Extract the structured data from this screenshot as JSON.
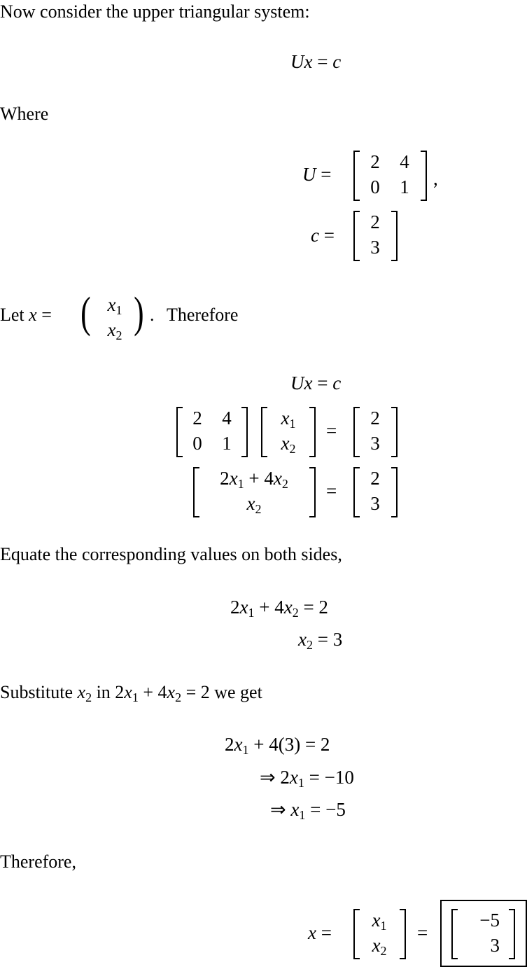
{
  "intro": "Now consider the upper triangular system:",
  "eq_main": {
    "lhs": "Ux",
    "eq": "=",
    "rhs": "c"
  },
  "where": "Where",
  "U_def": {
    "name": "U",
    "eq": "=",
    "rows": [
      [
        "2",
        "4"
      ],
      [
        "0",
        "1"
      ]
    ],
    "trail": ","
  },
  "c_def": {
    "name": "c",
    "eq": "=",
    "rows": [
      "2",
      "3"
    ]
  },
  "let": {
    "prefix": "Let",
    "var": "x",
    "eq": "=",
    "entries": [
      "x1",
      "x2"
    ],
    "suffix": ".",
    "after": "Therefore"
  },
  "system": {
    "line1": {
      "lhs": "Ux",
      "eq": "=",
      "rhs": "c"
    },
    "line2": {
      "U": [
        [
          "2",
          "4"
        ],
        [
          "0",
          "1"
        ]
      ],
      "x": [
        "x1",
        "x2"
      ],
      "eq": "=",
      "c": [
        "2",
        "3"
      ]
    },
    "line3": {
      "lhs": [
        "2x1 + 4x2",
        "x2"
      ],
      "eq": "=",
      "rhs": [
        "2",
        "3"
      ]
    }
  },
  "equate_text": "Equate the corresponding values on both sides,",
  "equations": [
    {
      "lhs": "2x1 + 4x2",
      "rhs": "= 2"
    },
    {
      "lhs": "x2",
      "rhs": "= 3"
    }
  ],
  "substitute_text": {
    "pre": "Substitute",
    "var": "x2",
    "mid": "in",
    "expr": "2x1 + 4x2 = 2",
    "post": "we get"
  },
  "solve_steps": [
    {
      "lhs": "2x1 + 4(3)",
      "rhs": "= 2"
    },
    {
      "lhs": "⇒ 2x1",
      "rhs": "= −10"
    },
    {
      "lhs": "⇒ x1",
      "rhs": "= −5"
    }
  ],
  "therefore": "Therefore,",
  "final": {
    "var": "x",
    "eq": "=",
    "entries": [
      "x1",
      "x2"
    ],
    "eq2": "=",
    "result": [
      "−5",
      "3"
    ]
  }
}
